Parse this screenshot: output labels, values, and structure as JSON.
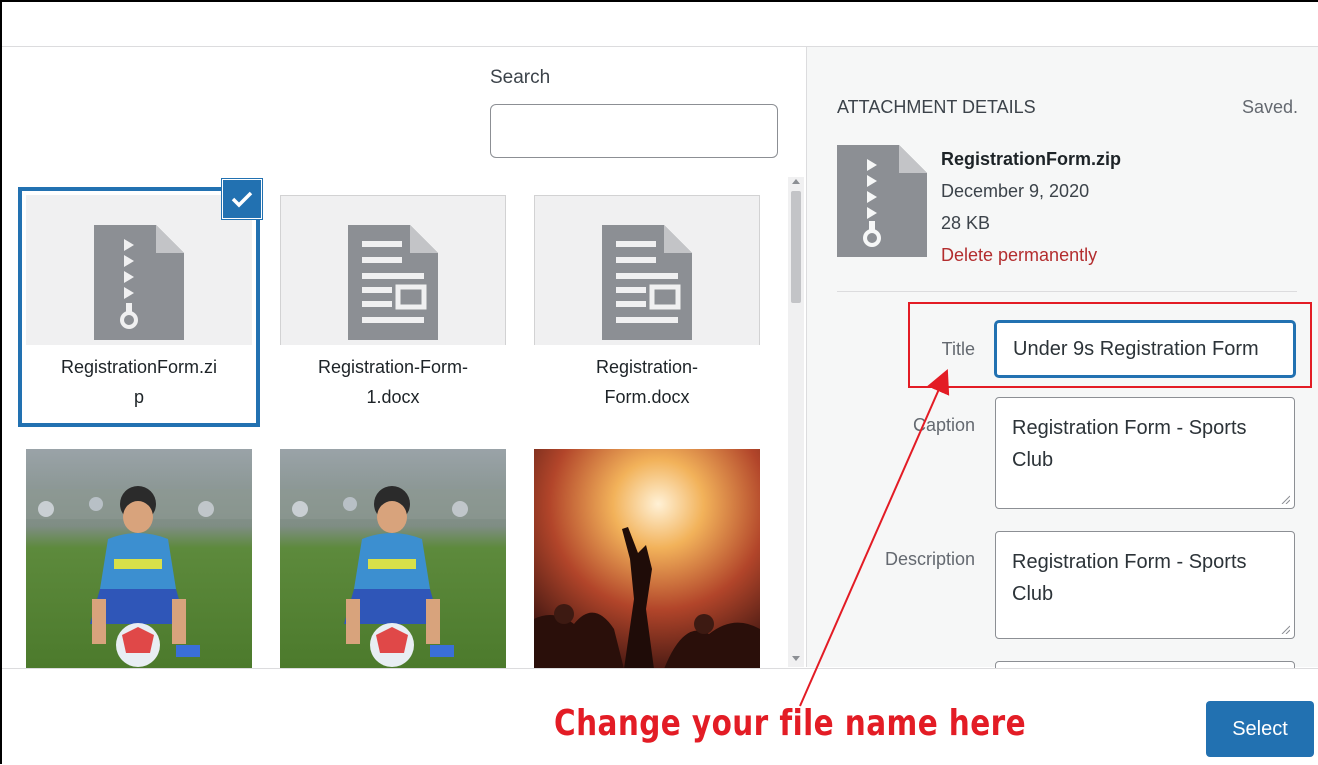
{
  "search": {
    "label": "Search",
    "value": ""
  },
  "library": {
    "items": [
      {
        "name": "RegistrationForm.zi\np",
        "type": "zip",
        "selected": true
      },
      {
        "name": "Registration-Form-\n1.docx",
        "type": "document",
        "selected": false
      },
      {
        "name": "Registration-\nForm.docx",
        "type": "document",
        "selected": false
      }
    ]
  },
  "details": {
    "heading": "Attachment Details",
    "status": "Saved.",
    "filename": "RegistrationForm.zip",
    "date": "December 9, 2020",
    "size": "28 KB",
    "delete_label": "Delete permanently",
    "title_label": "Title",
    "title_value": "Under 9s Registration Form",
    "caption_label": "Caption",
    "caption_value": "Registration Form - Sports Club",
    "description_label": "Description",
    "description_value": "Registration Form - Sports Club"
  },
  "annotation": {
    "text": "Change your file name here",
    "color": "#e31c25"
  },
  "footer": {
    "select_label": "Select"
  },
  "colors": {
    "accent": "#2271b1",
    "danger": "#b32d2e"
  }
}
